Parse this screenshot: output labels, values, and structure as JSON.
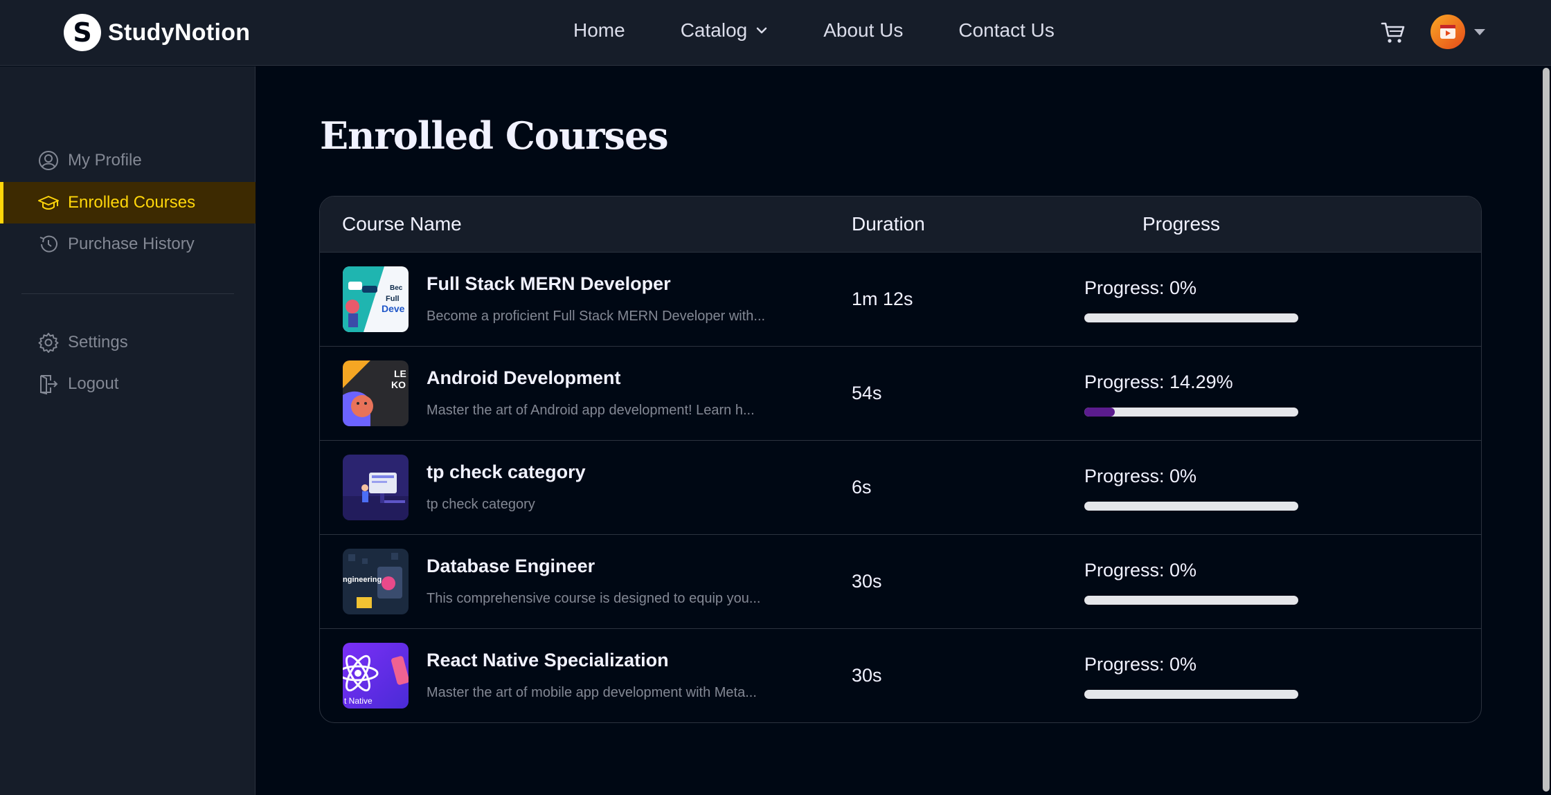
{
  "header": {
    "logo_mark": "S",
    "logo_text": "StudyNotion",
    "nav": [
      {
        "label": "Home",
        "has_dropdown": false
      },
      {
        "label": "Catalog",
        "has_dropdown": true
      },
      {
        "label": "About Us",
        "has_dropdown": false
      },
      {
        "label": "Contact Us",
        "has_dropdown": false
      }
    ],
    "icons": {
      "cart": "cart-icon",
      "avatar": "user-avatar",
      "caret": "caret-down-icon"
    }
  },
  "sidebar": {
    "items": [
      {
        "label": "My Profile",
        "icon": "user-circle-icon",
        "active": false
      },
      {
        "label": "Enrolled Courses",
        "icon": "graduation-cap-icon",
        "active": true
      },
      {
        "label": "Purchase History",
        "icon": "history-icon",
        "active": false
      }
    ],
    "bottom_items": [
      {
        "label": "Settings",
        "icon": "gear-icon"
      },
      {
        "label": "Logout",
        "icon": "logout-icon"
      }
    ]
  },
  "main": {
    "title": "Enrolled Courses",
    "columns": [
      "Course Name",
      "Duration",
      "Progress"
    ],
    "courses": [
      {
        "name": "Full Stack MERN Developer",
        "description": "Become a proficient Full Stack MERN Developer with...",
        "duration": "1m 12s",
        "progress_label": "Progress: 0%",
        "progress": 0,
        "thumb_text": "Full Deve"
      },
      {
        "name": "Android Development",
        "description": "Master the art of Android app development! Learn h...",
        "duration": "54s",
        "progress_label": "Progress: 14.29%",
        "progress": 14.29,
        "thumb_text": "LE KO"
      },
      {
        "name": "tp check category",
        "description": "tp check category",
        "duration": "6s",
        "progress_label": "Progress: 0%",
        "progress": 0,
        "thumb_text": ""
      },
      {
        "name": "Database Engineer",
        "description": "This comprehensive course is designed to equip you...",
        "duration": "30s",
        "progress_label": "Progress: 0%",
        "progress": 0,
        "thumb_text": "ngineering"
      },
      {
        "name": "React Native Specialization",
        "description": "Master the art of mobile app development with Meta...",
        "duration": "30s",
        "progress_label": "Progress: 0%",
        "progress": 0,
        "thumb_text": "t Native"
      }
    ]
  },
  "colors": {
    "background": "#000814",
    "panel": "#161D29",
    "accent": "#FFD60A",
    "progress_fill": "#5B1C8E"
  }
}
